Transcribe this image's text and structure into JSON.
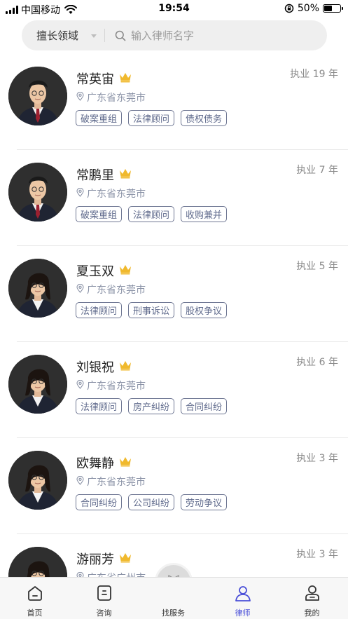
{
  "status_bar": {
    "carrier": "中国移动",
    "time": "19:54",
    "battery_text": "50%",
    "battery_level": 0.5
  },
  "search": {
    "field_select_label": "擅长领域",
    "placeholder": "输入律师名字",
    "value": ""
  },
  "lawyers": [
    {
      "name": "常英宙",
      "years": "执业 19 年",
      "location": "广东省东莞市",
      "tags": [
        "破案重组",
        "法律顾问",
        "债权债务"
      ],
      "avatar": "male-1"
    },
    {
      "name": "常鹏里",
      "years": "执业 7 年",
      "location": "广东省东莞市",
      "tags": [
        "破案重组",
        "法律顾问",
        "收购兼并"
      ],
      "avatar": "male-2"
    },
    {
      "name": "夏玉双",
      "years": "执业 5 年",
      "location": "广东省东莞市",
      "tags": [
        "法律顾问",
        "刑事诉讼",
        "股权争议"
      ],
      "avatar": "female-1"
    },
    {
      "name": "刘银祝",
      "years": "执业 6 年",
      "location": "广东省东莞市",
      "tags": [
        "法律顾问",
        "房产纠纷",
        "合同纠纷"
      ],
      "avatar": "female-2"
    },
    {
      "name": "欧舞静",
      "years": "执业 3 年",
      "location": "广东省东莞市",
      "tags": [
        "合同纠纷",
        "公司纠纷",
        "劳动争议"
      ],
      "avatar": "female-3"
    },
    {
      "name": "游丽芳",
      "years": "执业 3 年",
      "location": "广东省广州市",
      "tags": [
        "",
        "",
        ""
      ],
      "avatar": "female-4"
    }
  ],
  "tabs": [
    {
      "label": "首页",
      "icon": "home-icon"
    },
    {
      "label": "咨询",
      "icon": "chat-icon"
    },
    {
      "label": "找服务",
      "icon": "tie-icon"
    },
    {
      "label": "律师",
      "icon": "lawyer-icon",
      "active": true
    },
    {
      "label": "我的",
      "icon": "profile-icon"
    }
  ],
  "colors": {
    "accent": "#4a4fd8",
    "crown": "#f0b92d",
    "tag_border": "#6f7793",
    "secondary_text": "#8b93a7"
  }
}
